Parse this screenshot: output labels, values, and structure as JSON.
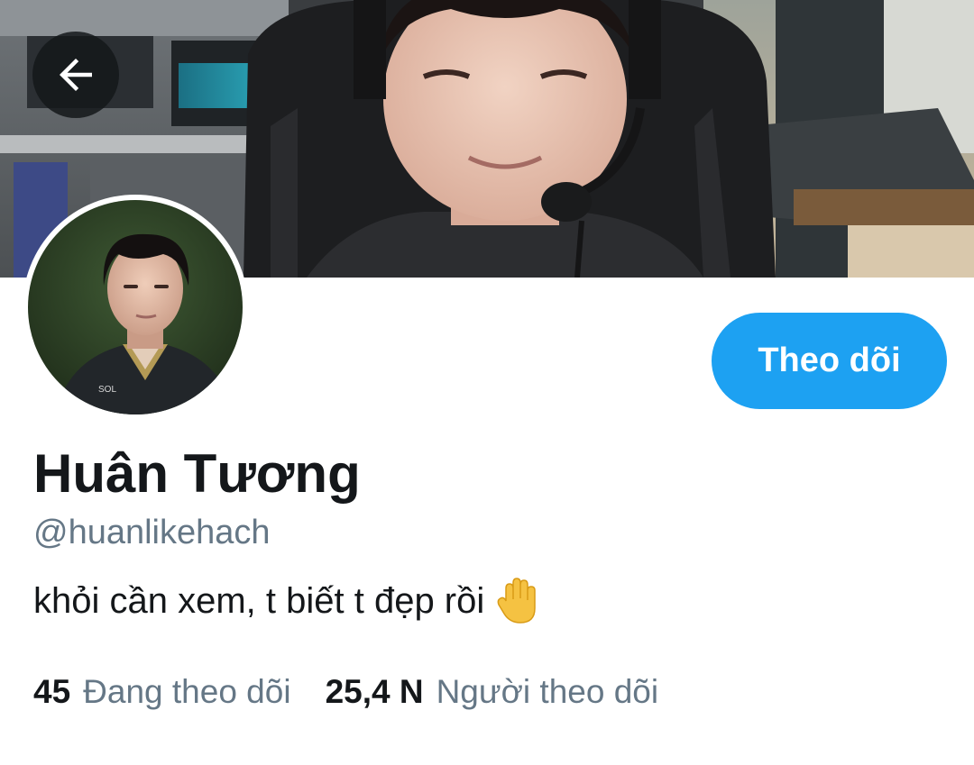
{
  "navigation": {
    "back_icon": "arrow-left-icon"
  },
  "banner": {
    "description_icon": "header-photo"
  },
  "profile": {
    "display_name": "Huân Tương",
    "handle": "@huanlikehach",
    "bio_text": "khỏi cần xem, t biết t đẹp rồi",
    "bio_emoji": "raised-hand-icon",
    "avatar_icon": "avatar-photo"
  },
  "actions": {
    "follow_label": "Theo dõi"
  },
  "stats": {
    "following_count": "45",
    "following_label": "Đang theo dõi",
    "followers_count": "25,4 N",
    "followers_label": "Người theo dõi"
  },
  "colors": {
    "accent": "#1da1f2",
    "primary_text": "#14171a",
    "secondary_text": "#657786",
    "background": "#ffffff"
  }
}
